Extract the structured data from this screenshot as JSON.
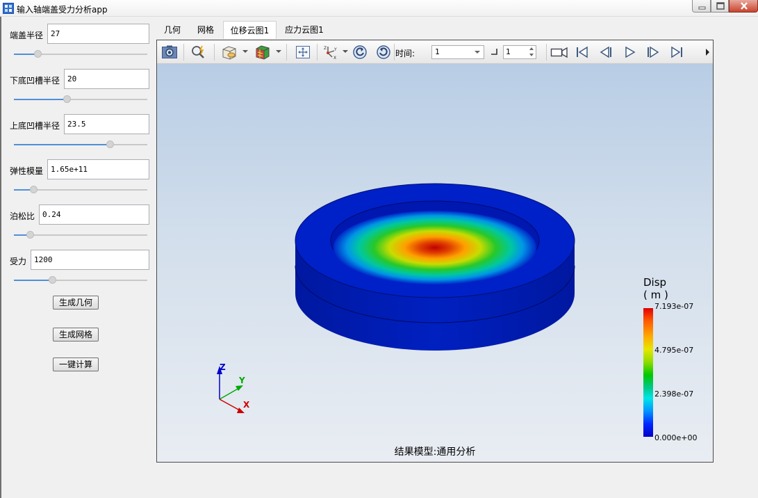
{
  "window": {
    "title": "输入轴端盖受力分析app",
    "icon": "app-window-icon",
    "controls": [
      "minimize-icon",
      "maximize-icon",
      "close-icon"
    ]
  },
  "params": [
    {
      "label": "端盖半径",
      "value": "27",
      "slider_fraction": 0.18
    },
    {
      "label": "下底凹槽半径",
      "value": "20",
      "slider_fraction": 0.4
    },
    {
      "label": "上底凹槽半径",
      "value": "23.5",
      "slider_fraction": 0.72
    },
    {
      "label": "弹性模量",
      "value": "1.65e+11",
      "slider_fraction": 0.15
    },
    {
      "label": "泊松比",
      "value": "0.24",
      "slider_fraction": 0.12
    },
    {
      "label": "受力",
      "value": "1200",
      "slider_fraction": 0.29
    }
  ],
  "buttons": {
    "gen_geometry": "生成几何",
    "gen_mesh": "生成网格",
    "compute": "一键计算"
  },
  "tabs": [
    {
      "label": "几何",
      "active": false
    },
    {
      "label": "网格",
      "active": false
    },
    {
      "label": "位移云图1",
      "active": true
    },
    {
      "label": "应力云图1",
      "active": false
    }
  ],
  "toolbar": {
    "icons": [
      "camera-icon",
      "zoom-icon",
      "cube-view-icon",
      "render-mode-icon",
      "fit-view-icon",
      "axes-orientation-icon",
      "rotate-left-icon",
      "rotate-right-icon"
    ],
    "time_label": "时间:",
    "time_value": "1",
    "step_value": "1",
    "playback_icons": [
      "record-icon",
      "first-frame-icon",
      "step-back-icon",
      "play-icon",
      "step-forward-icon",
      "last-frame-icon"
    ]
  },
  "legend": {
    "title": "Disp",
    "unit": "( m )",
    "max": "7.193e-07",
    "tick2": "4.795e-07",
    "tick3": "2.398e-07",
    "min": "0.000e+00"
  },
  "triad": {
    "z": "Z",
    "y": "Y",
    "x": "X"
  },
  "footer": "结果模型:通用分析",
  "colors": {
    "accent": "#4f8fd8",
    "disp_max": "#e00000",
    "disp_min": "#0000c8",
    "scene_top": "#b8cde5",
    "scene_bottom": "#e9edf3"
  }
}
